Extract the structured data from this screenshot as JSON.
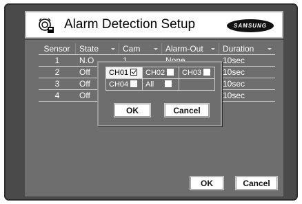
{
  "title": "Alarm Detection Setup",
  "brand": "SAMSUNG",
  "table": {
    "headers": [
      "Sensor",
      "State",
      "Cam",
      "Alarm-Out",
      "Duration"
    ],
    "rows": [
      {
        "sensor": "1",
        "state": "N.O",
        "cam": "1",
        "alarm_out": "None",
        "duration": "10sec"
      },
      {
        "sensor": "2",
        "state": "Off",
        "cam": "",
        "alarm_out": "",
        "duration": "10sec"
      },
      {
        "sensor": "3",
        "state": "Off",
        "cam": "",
        "alarm_out": "",
        "duration": "10sec"
      },
      {
        "sensor": "4",
        "state": "Off",
        "cam": "",
        "alarm_out": "",
        "duration": "10sec"
      }
    ]
  },
  "popup": {
    "channels": [
      {
        "label": "CH01",
        "checked": true
      },
      {
        "label": "CH02",
        "checked": false
      },
      {
        "label": "CH03",
        "checked": false
      },
      {
        "label": "CH04",
        "checked": false
      },
      {
        "label": "All",
        "checked": false
      }
    ],
    "ok_label": "OK",
    "cancel_label": "Cancel"
  },
  "footer": {
    "ok_label": "OK",
    "cancel_label": "Cancel"
  },
  "icons": {
    "title": "alarm-sensor-icon",
    "dropdown": "triangle-down-icon"
  }
}
